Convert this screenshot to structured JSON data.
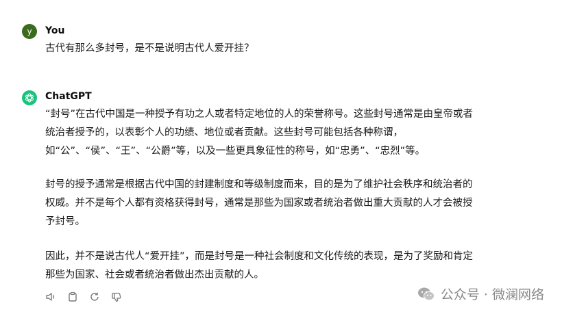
{
  "user": {
    "avatar_letter": "y",
    "name": "You",
    "message": "古代有那么多封号，是不是说明古代人爱开挂？"
  },
  "assistant": {
    "name": "ChatGPT",
    "paragraphs": [
      [
        "“封号”在古代中国是一种授予有功之人或者特定地位的人的荣誉称号。这些封号通常是由皇帝或者",
        "统治者授予的，以表彰个人的功绩、地位或者贡献。这些封号可能包括各种称谓，",
        "如“公”、“侯”、“王”、“公爵”等，以及一些更具象征性的称号，如“忠勇”、“忠烈”等。"
      ],
      [
        "封号的授予通常是根据古代中国的封建制度和等级制度而来，目的是为了维护社会秩序和统治者的",
        "权威。并不是每个人都有资格获得封号，通常是那些为国家或者统治者做出重大贡献的人才会被授",
        "予封号。"
      ],
      [
        "因此，并不是说古代人“爱开挂”，而是封号是一种社会制度和文化传统的表现，是为了奖励和肯定",
        "那些为国家、社会或者统治者做出杰出贡献的人。"
      ]
    ],
    "actions": [
      "speaker-icon",
      "copy-icon",
      "regenerate-icon",
      "thumbs-down-icon"
    ]
  },
  "watermark": {
    "text": "公众号 · 微澜网络"
  },
  "colors": {
    "user_avatar": "#3a6b1f",
    "gpt_avatar": "#19c37d",
    "text": "#1a1a1a",
    "watermark": "#8a8a8a"
  }
}
